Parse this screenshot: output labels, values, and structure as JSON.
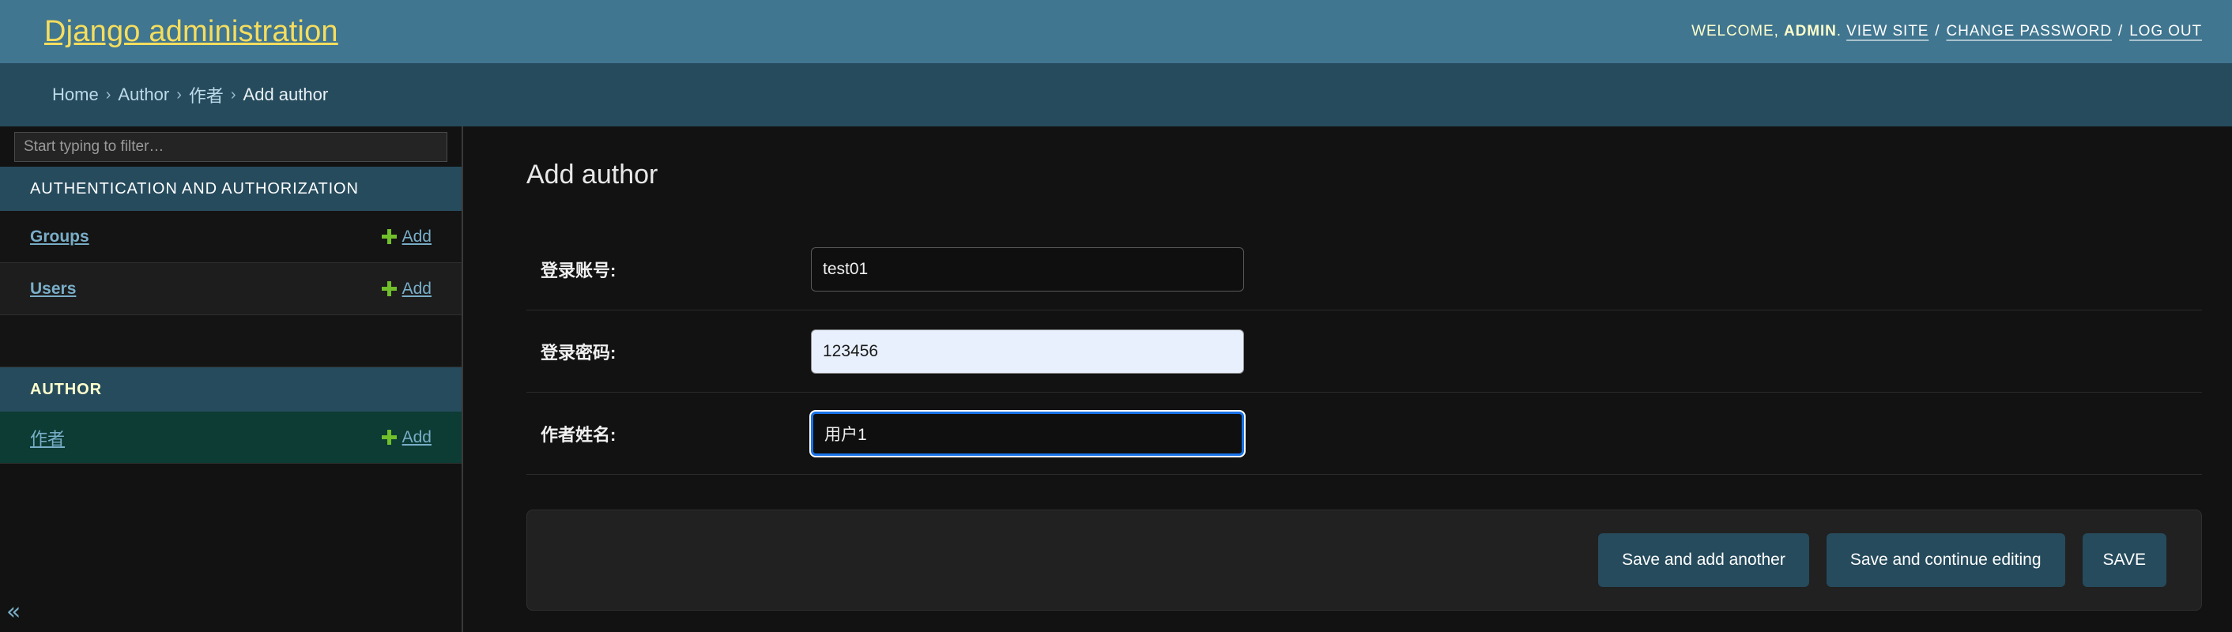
{
  "header": {
    "title": "Django administration",
    "welcome_prefix": "WELCOME,",
    "username": "ADMIN",
    "username_suffix": ".",
    "links": [
      {
        "label": "VIEW SITE",
        "name": "view-site-link"
      },
      {
        "label": "CHANGE PASSWORD",
        "name": "change-password-link"
      },
      {
        "label": "LOG OUT",
        "name": "log-out-link"
      }
    ],
    "separator": "/"
  },
  "breadcrumbs": {
    "items": [
      {
        "label": "Home",
        "current": false
      },
      {
        "label": "Author",
        "current": false
      },
      {
        "label": "作者",
        "current": false
      },
      {
        "label": "Add author",
        "current": true
      }
    ],
    "separator": "›"
  },
  "sidebar": {
    "filter": {
      "placeholder": "Start typing to filter…",
      "value": ""
    },
    "apps": [
      {
        "name": "AUTHENTICATION AND AUTHORIZATION",
        "current": false,
        "models": [
          {
            "label": "Groups",
            "add_label": "Add",
            "current": false
          },
          {
            "label": "Users",
            "add_label": "Add",
            "current": false
          }
        ]
      },
      {
        "name": "AUTHOR",
        "current": true,
        "models": [
          {
            "label": "作者",
            "add_label": "Add",
            "current": true
          }
        ]
      }
    ],
    "collapse_icon": "«"
  },
  "main": {
    "title": "Add author",
    "fields": [
      {
        "label": "登录账号:",
        "value": "test01",
        "state": "normal",
        "name": "login-account"
      },
      {
        "label": "登录密码:",
        "value": "123456",
        "state": "autofilled",
        "name": "login-password"
      },
      {
        "label": "作者姓名:",
        "value": "用户1",
        "state": "focused",
        "name": "author-name"
      }
    ],
    "submit_buttons": [
      {
        "label": "Save and add another",
        "name": "save-and-add-another-button"
      },
      {
        "label": "Save and continue editing",
        "name": "save-and-continue-editing-button"
      },
      {
        "label": "SAVE",
        "name": "save-button"
      }
    ]
  },
  "colors": {
    "header_bg": "#417690",
    "breadcrumb_bg": "#264b5d",
    "brand_yellow": "#f5dd5d",
    "link_blue": "#79aec8",
    "add_green": "#70bf2b",
    "current_model_bg": "#0c3c34",
    "focus_blue": "#1a73e8",
    "autofill_bg": "#e8f0fe",
    "page_bg": "#121212"
  }
}
